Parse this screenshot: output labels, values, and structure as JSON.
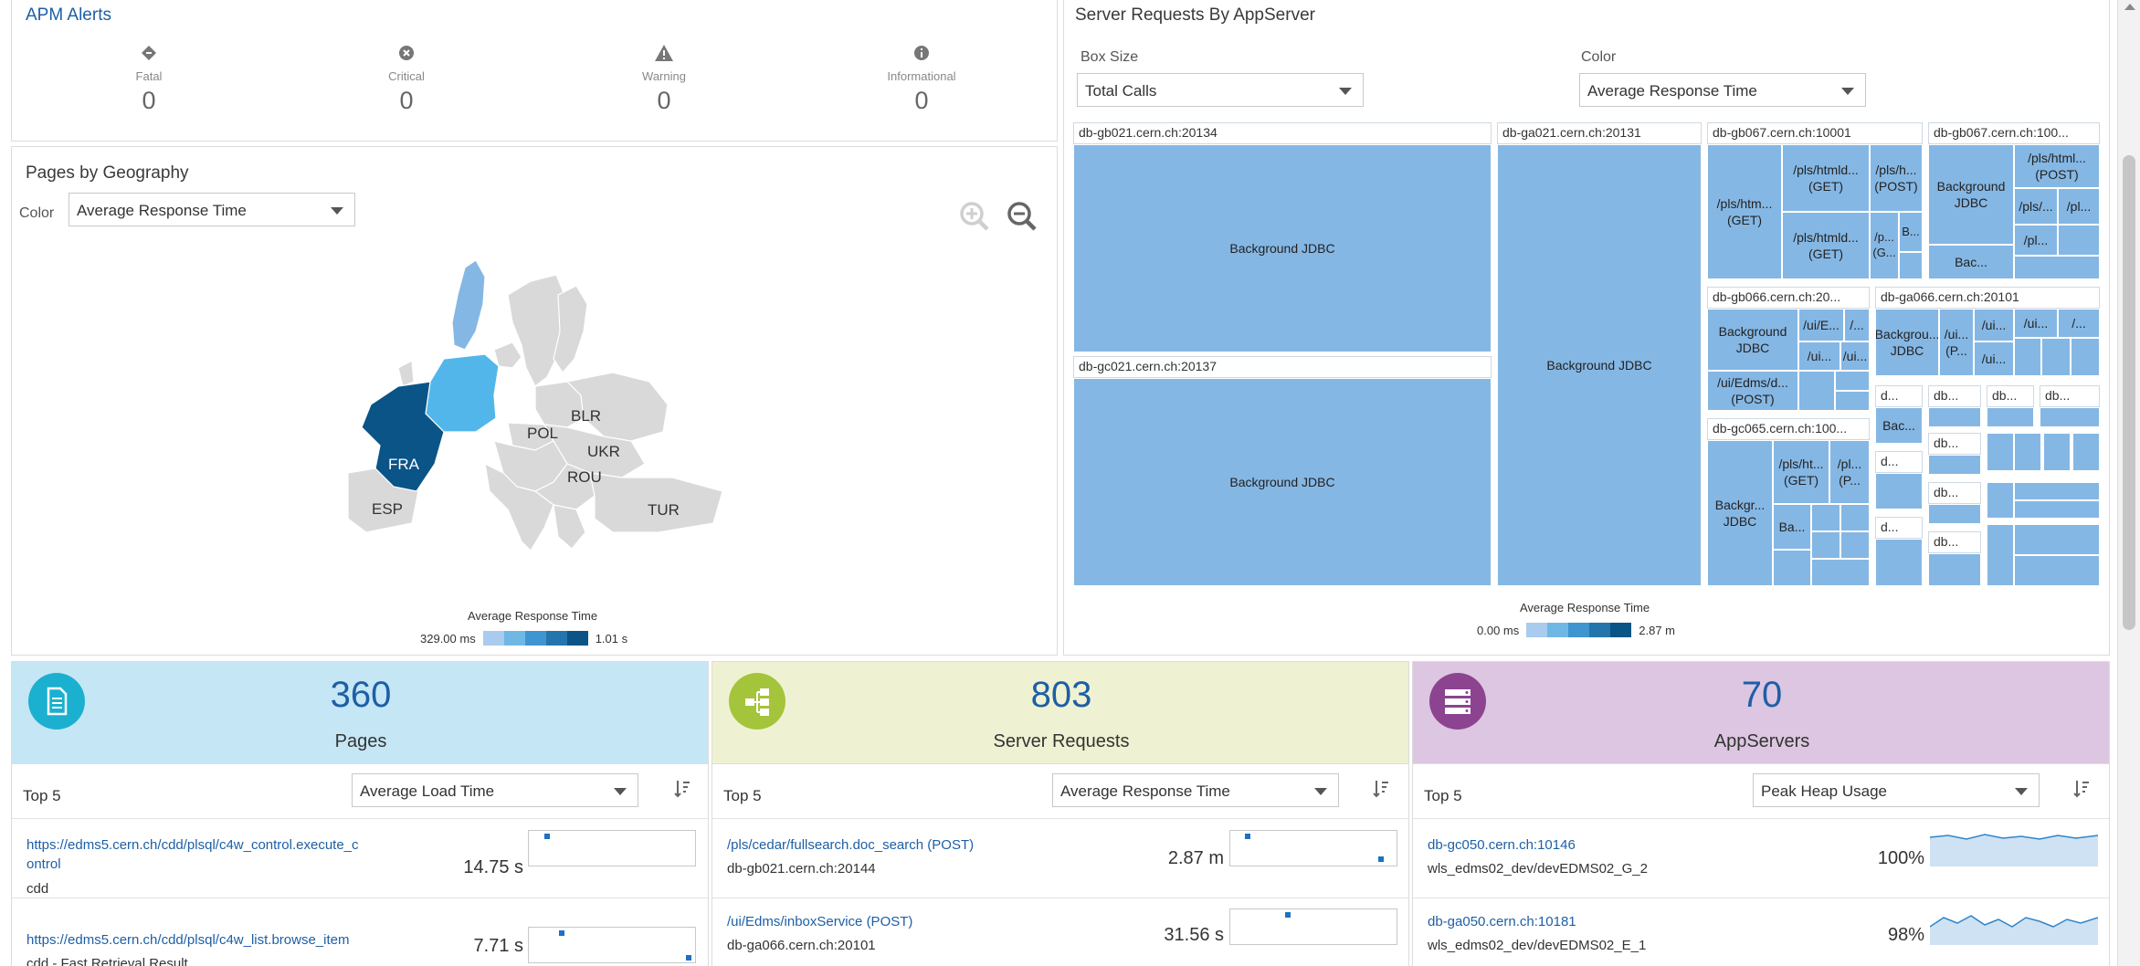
{
  "alerts": {
    "title": "APM Alerts",
    "items": [
      {
        "label": "Fatal",
        "count": "0",
        "icon": "fatal-icon"
      },
      {
        "label": "Critical",
        "count": "0",
        "icon": "critical-icon"
      },
      {
        "label": "Warning",
        "count": "0",
        "icon": "warning-icon"
      },
      {
        "label": "Informational",
        "count": "0",
        "icon": "info-icon"
      }
    ]
  },
  "geo": {
    "title": "Pages by Geography",
    "color_label": "Color",
    "color_value": "Average Response Time",
    "countries": [
      "BLR",
      "POL",
      "UKR",
      "FRA",
      "ROU",
      "ESP",
      "TUR"
    ],
    "legend_title": "Average Response Time",
    "legend_min": "329.00 ms",
    "legend_max": "1.01 s",
    "colors": {
      "high": "#0a5487",
      "mid": "#52b6ea",
      "low": "#85b7e4",
      "none": "#d9d9d9"
    }
  },
  "treemap": {
    "title": "Server Requests By AppServer",
    "boxsize_label": "Box Size",
    "boxsize_value": "Total Calls",
    "color_label": "Color",
    "color_value": "Average Response Time",
    "groups": {
      "g1": "db-gb021.cern.ch:20134",
      "g2": "db-gc021.cern.ch:20137",
      "g3": "db-ga021.cern.ch:20131",
      "g4": "db-gb067.cern.ch:10001",
      "g5": "db-gb067.cern.ch:100...",
      "g6": "db-gb066.cern.ch:20...",
      "g7": "db-ga066.cern.ch:20101",
      "g8": "db-gc065.cern.ch:100..."
    },
    "labels": {
      "bg": "Background JDBC",
      "bg_short": "Background JDBC",
      "bgr": "Backgr... JDBC",
      "bgro": "Backgrou... JDBC",
      "ba": "Ba...",
      "bac": "Bac...",
      "bac2": "Bac...",
      "pls_get1": "/pls/htm... (GET)",
      "pls_get2": "/pls/htmld... (GET)",
      "pls_get3": "/pls/htmld... (GET)",
      "pls_post": "/pls/h... (POST)",
      "pls_post2": "/pls/html... (POST)",
      "pl1": "/pls/...",
      "pl2": "/pl...",
      "pl3": "/pl...",
      "pg": "/p... (G...",
      "b": "B...",
      "ui1": "/ui/E...",
      "ui2": "/...",
      "ui3": "/ui...",
      "ui4": "/ui...",
      "ui5": "/ui/Edms/d... (POST)",
      "uip": "/ui... (P...",
      "ui6": "/ui...",
      "ui7": "/ui...",
      "ui8": "/ui...",
      "ui9": "/...",
      "plsht": "/pls/ht... (GET)",
      "plp": "/pl... (P...",
      "d1": "d...",
      "d2": "d...",
      "d3": "d...",
      "db1": "db...",
      "db2": "db...",
      "db3": "db...",
      "db4": "db...",
      "db5": "db...",
      "db6": "db..."
    },
    "legend_title": "Average Response Time",
    "legend_min": "0.00 ms",
    "legend_max": "2.87 m"
  },
  "cards": [
    {
      "count": "360",
      "label": "Pages",
      "top": "Top 5",
      "metric": "Average Load Time",
      "bg": "#c5e6f5",
      "circle": "#1bb0cf",
      "icon": "document-icon",
      "rows": [
        {
          "title": "https://edms5.cern.ch/cdd/plsql/c4w_control.execute_c\nontrol",
          "sub": "cdd",
          "value": "14.75 s"
        },
        {
          "title": "https://edms5.cern.ch/cdd/plsql/c4w_list.browse_item",
          "sub": "cdd - Fast Retrieval Result",
          "value": "7.71 s"
        }
      ]
    },
    {
      "count": "803",
      "label": "Server Requests",
      "top": "Top 5",
      "metric": "Average Response Time",
      "bg": "#eff2d2",
      "circle": "#a4c43b",
      "icon": "hierarchy-icon",
      "rows": [
        {
          "title": "/pls/cedar/fullsearch.doc_search (POST)",
          "sub": "db-gb021.cern.ch:20144",
          "value": "2.87 m"
        },
        {
          "title": "/ui/Edms/inboxService (POST)",
          "sub": "db-ga066.cern.ch:20101",
          "value": "31.56 s"
        }
      ]
    },
    {
      "count": "70",
      "label": "AppServers",
      "top": "Top 5",
      "metric": "Peak Heap Usage",
      "bg": "#dcc6e1",
      "circle": "#8c4390",
      "icon": "server-icon",
      "rows": [
        {
          "title": "db-gc050.cern.ch:10146",
          "sub": "wls_edms02_dev/devEDMS02_G_2",
          "value": "100%"
        },
        {
          "title": "db-ga050.cern.ch:10181",
          "sub": "wls_edms02_dev/devEDMS02_E_1",
          "value": "98%"
        }
      ]
    }
  ]
}
